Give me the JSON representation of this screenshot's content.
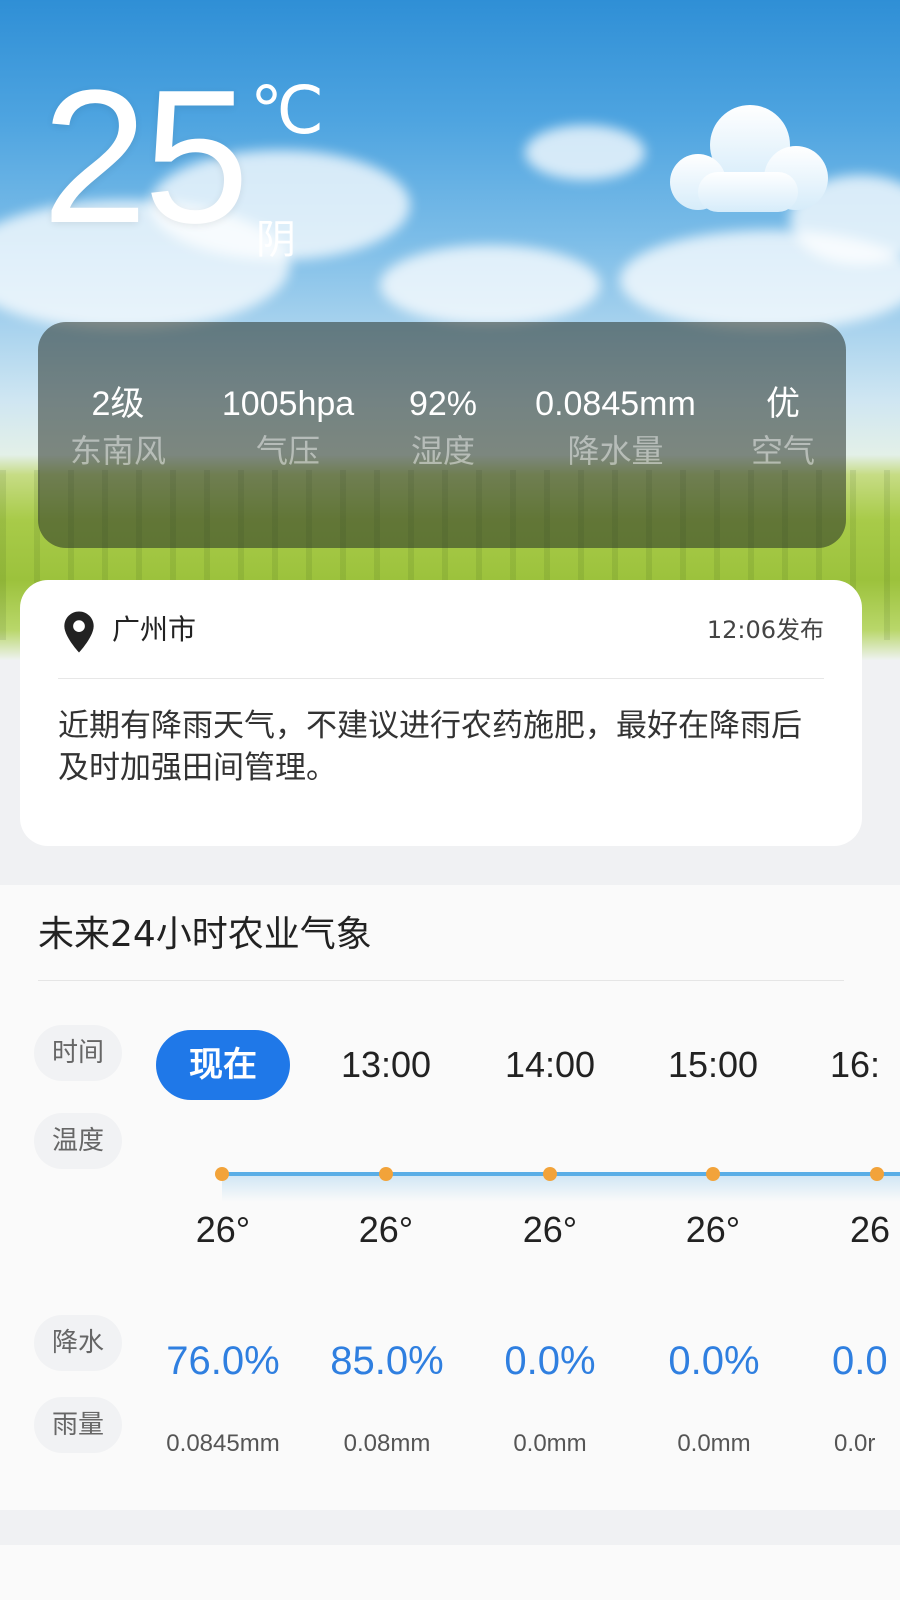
{
  "current": {
    "temperature": "25",
    "unit": "℃",
    "condition": "阴",
    "icon": "cloud-icon"
  },
  "stats": [
    {
      "value": "2级",
      "label": "东南风"
    },
    {
      "value": "1005hpa",
      "label": "气压"
    },
    {
      "value": "92%",
      "label": "湿度"
    },
    {
      "value": "0.0845mm",
      "label": "降水量"
    },
    {
      "value": "优",
      "label": "空气"
    }
  ],
  "location": {
    "city": "广州市",
    "published": "12:06发布",
    "advice": "近期有降雨天气，不建议进行农药施肥，最好在降雨后及时加强田间管理。"
  },
  "forecast": {
    "title": "未来24小时农业气象",
    "row_labels": {
      "time": "时间",
      "temp": "温度",
      "precip": "降水",
      "rain": "雨量"
    },
    "hours": [
      {
        "time": "现在",
        "temp": "26°",
        "precip": "76.0%",
        "rain": "0.0845mm"
      },
      {
        "time": "13:00",
        "temp": "26°",
        "precip": "85.0%",
        "rain": "0.08mm"
      },
      {
        "time": "14:00",
        "temp": "26°",
        "precip": "0.0%",
        "rain": "0.0mm"
      },
      {
        "time": "15:00",
        "temp": "26°",
        "precip": "0.0%",
        "rain": "0.0mm"
      },
      {
        "time": "16:",
        "temp": "26",
        "precip": "0.0",
        "rain": "0.0r"
      }
    ]
  },
  "colors": {
    "accent": "#1f78e8",
    "precip_text": "#2f7fe0",
    "temp_line": "#5aaee6",
    "temp_dot": "#f2a33a"
  }
}
